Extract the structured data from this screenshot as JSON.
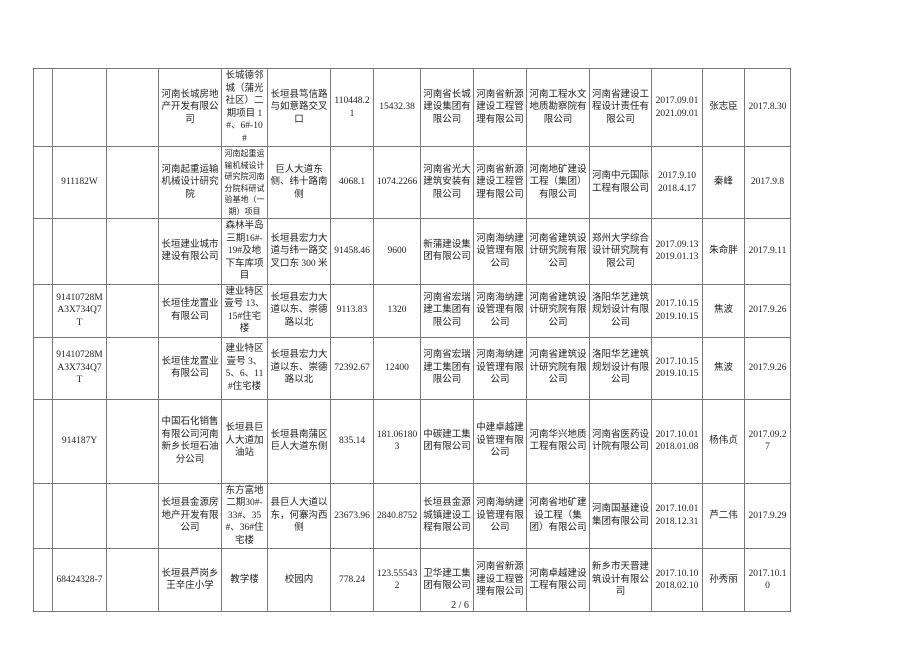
{
  "rows": [
    {
      "c0": "",
      "c1": "",
      "c2": "",
      "c3": "河南长城房地产开发有限公司",
      "c4": "长城德邻城（蒲光社区）二期项目 1#、6#-10#",
      "c5": "长垣县笃信路与如意路交叉口",
      "c6": "110448.21",
      "c7": "15432.38",
      "c8": "河南省长城建设集团有限公司",
      "c9": "河南省新源建设工程管理有限公司",
      "c10": "河南工程水文地质勘察院有限公司",
      "c11": "河南省建设工程设计责任有限公司",
      "c12a": "2017.09.01",
      "c12b": "2021.09.01",
      "c13": "张志臣",
      "c14": "2017.8.30"
    },
    {
      "c0": "",
      "c1": "911182W",
      "c2": "",
      "c3": "河南起重运输机械设计研究院",
      "c4": "河南起重运输机械设计研究院河南分院科研试验基地（一期）项目",
      "c5": "巨人大道东侧、纬十路南侧",
      "c6": "4068.1",
      "c7": "1074.2266",
      "c8": "河南省光大建筑安装有限公司",
      "c9": "河南省新源建设工程管理有限公司",
      "c10": "河南地矿建设工程（集团）有限公司",
      "c11": "河南中元国际工程有限公司",
      "c12a": "2017.9.10",
      "c12b": "2018.4.17",
      "c13": "秦峰",
      "c14": "2017.9.8"
    },
    {
      "c0": "",
      "c1": "",
      "c2": "",
      "c3": "长垣建业城市建设有限公司",
      "c4": "森林半岛三期16#-19#及地下车库项目",
      "c5": "长垣县宏力大道与纬一路交叉口东 300 米",
      "c6": "91458.46",
      "c7": "9600",
      "c8": "新蒲建设集团有限公司",
      "c9": "河南海纳建设管理有限公司",
      "c10": "河南省建筑设计研究院有限公司",
      "c11": "郑州大学综合设计研究院有限公司",
      "c12a": "2017.09.13",
      "c12b": "2019.01.13",
      "c13": "朱命胖",
      "c14": "2017.9.11"
    },
    {
      "c0": "",
      "c1": "91410728MA3X734Q7T",
      "c2": "",
      "c3": "长垣佳龙置业有限公司",
      "c4": "建业特区壹号 13、15#住宅楼",
      "c5": "长垣县宏力大道以东、崇德路以北",
      "c6": "9113.83",
      "c7": "1320",
      "c8": "河南省宏瑞建工集团有限公司",
      "c9": "河南海纳建设管理有限公司",
      "c10": "河南省建筑设计研究院有限公司",
      "c11": "洛阳华艺建筑规划设计有限公司",
      "c12a": "2017.10.15",
      "c12b": "2019.10.15",
      "c13": "焦波",
      "c14": "2017.9.26"
    },
    {
      "c0": "",
      "c1": "91410728MA3X734Q7T",
      "c2": "",
      "c3": "长垣佳龙置业有限公司",
      "c4": "建业特区壹号 3、5、6、11#住宅楼",
      "c5": "长垣县宏力大道以东、崇德路以北",
      "c6": "72392.67",
      "c7": "12400",
      "c8": "河南省宏瑞建工集团有限公司",
      "c9": "河南海纳建设管理有限公司",
      "c10": "河南省建筑设计研究院有限公司",
      "c11": "洛阳华艺建筑规划设计有限公司",
      "c12a": "2017.10.15",
      "c12b": "2019.10.15",
      "c13": "焦波",
      "c14": "2017.9.26"
    },
    {
      "c0": "",
      "c1": "914187Y",
      "c2": "",
      "c3": "中国石化销售有限公司河南新乡长垣石油分公司",
      "c4": "长垣县巨人大道加油站",
      "c5": "长垣县南蒲区巨人大道东侧",
      "c6": "835.14",
      "c7": "181.061803",
      "c8": "中碳建工集团有限公司",
      "c9": "中建卓越建设管理有限公司",
      "c10": "河南华兴地质工程有限公司",
      "c11": "河南省医药设计院有限公司",
      "c12a": "2017.10.01",
      "c12b": "2018.01.08",
      "c13": "杨伟贞",
      "c14": "2017.09.27"
    },
    {
      "c0": "",
      "c1": "",
      "c2": "",
      "c3": "长垣县金源房地产开发有限公司",
      "c4": "东方富地二期30#-33#、35#、36#住宅楼",
      "c5": "县巨人大道以东，何寨沟西侧",
      "c6": "23673.96",
      "c7": "2840.8752",
      "c8": "长垣县金源城镇建设工程有限公司",
      "c9": "河南海纳建设管理有限公司",
      "c10": "河南省地矿建设工程（集团）有限公司",
      "c11": "河南国基建设集团有限公司",
      "c12a": "2017.10.01",
      "c12b": "2018.12.31",
      "c13": "芦二伟",
      "c14": "2017.9.29"
    },
    {
      "c0": "",
      "c1": "68424328-7",
      "c2": "",
      "c3": "长垣县芦岗乡王辛庄小学",
      "c4": "教学楼",
      "c5": "校园内",
      "c6": "778.24",
      "c7": "123.555432",
      "c8": "卫华建工集团有限公司",
      "c9": "河南省新源建设工程管理有限公司",
      "c10": "河南卓越建设工程有限公司",
      "c11": "新乡市天晋建筑设计有限公司",
      "c12a": "2017.10.10",
      "c12b": "2018.02.10",
      "c13": "孙秀丽",
      "c14": "2017.10.10"
    }
  ],
  "page_number": "2 / 6"
}
